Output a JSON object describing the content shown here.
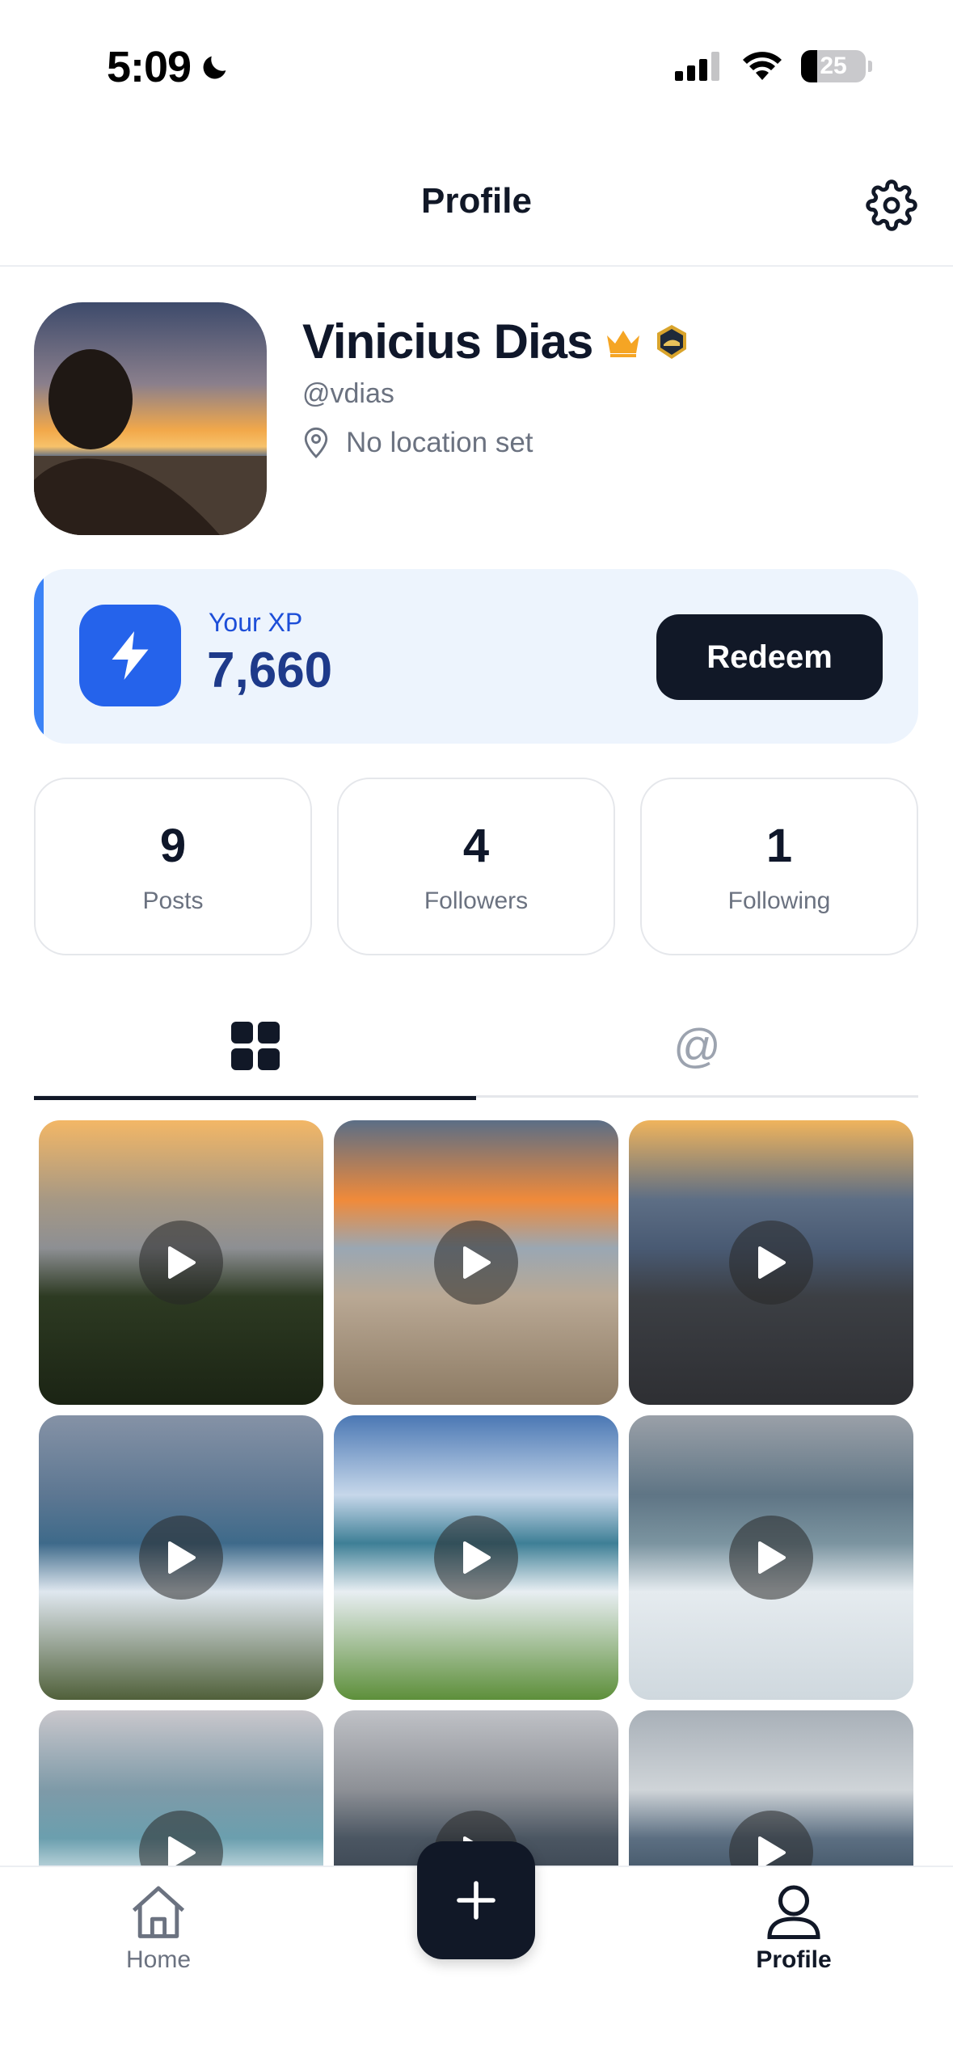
{
  "status_bar": {
    "time": "5:09",
    "battery_level": "25",
    "battery_fraction": 0.25
  },
  "header": {
    "title": "Profile",
    "settings_icon": "gear-icon"
  },
  "profile": {
    "name": "Vinicius Dias",
    "handle": "@vdias",
    "location": "No location set",
    "badges": [
      "crown-icon",
      "shield-badge-icon"
    ],
    "accent_color": "#f5a524"
  },
  "xp": {
    "label": "Your XP",
    "value": "7,660",
    "redeem_label": "Redeem",
    "icon": "lightning-icon",
    "accent_color": "#2563eb"
  },
  "stats": [
    {
      "value": "9",
      "label": "Posts"
    },
    {
      "value": "4",
      "label": "Followers"
    },
    {
      "value": "1",
      "label": "Following"
    }
  ],
  "tabs": {
    "grid_icon": "grid-icon",
    "mentions_label": "@"
  },
  "posts": [
    {
      "type": "video",
      "scene": "sunset-grass"
    },
    {
      "type": "video",
      "scene": "sunrise-beach"
    },
    {
      "type": "video",
      "scene": "dusk-sand"
    },
    {
      "type": "video",
      "scene": "waves-rocks"
    },
    {
      "type": "video",
      "scene": "sky-rocks-green"
    },
    {
      "type": "video",
      "scene": "grey-surf"
    },
    {
      "type": "video",
      "scene": "pine-surf"
    },
    {
      "type": "video",
      "scene": "grey-sea"
    },
    {
      "type": "video",
      "scene": "cloudy-shore"
    }
  ],
  "bottom_nav": {
    "home_label": "Home",
    "profile_label": "Profile",
    "add_icon": "plus-icon"
  }
}
